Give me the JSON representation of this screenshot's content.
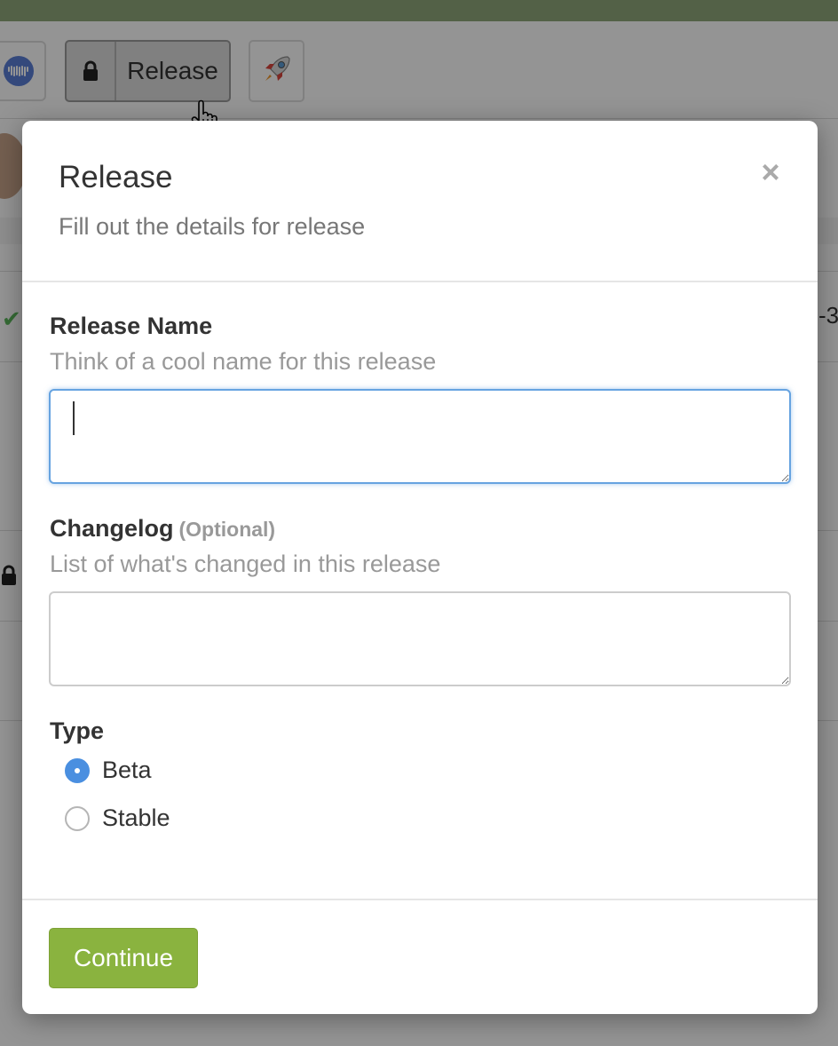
{
  "toolbar": {
    "release_button_label": "Release",
    "app_icon": "waveform-icon",
    "rocket_icon": "rocket-icon"
  },
  "background": {
    "edge_text": "-3"
  },
  "modal": {
    "title": "Release",
    "subtitle": "Fill out the details for release",
    "close_label": "×",
    "release_name": {
      "label": "Release Name",
      "help": "Think of a cool name for this release",
      "value": "",
      "placeholder": ""
    },
    "changelog": {
      "label": "Changelog",
      "optional_label": "(Optional)",
      "help": "List of what's changed in this release",
      "value": "",
      "placeholder": ""
    },
    "type": {
      "label": "Type",
      "options": [
        {
          "label": "Beta",
          "checked": true
        },
        {
          "label": "Stable",
          "checked": false
        }
      ]
    },
    "continue_label": "Continue"
  },
  "colors": {
    "primary_button": "#8ab33f",
    "focus_border": "#66a3e0",
    "radio_checked": "#4a8fe0"
  }
}
